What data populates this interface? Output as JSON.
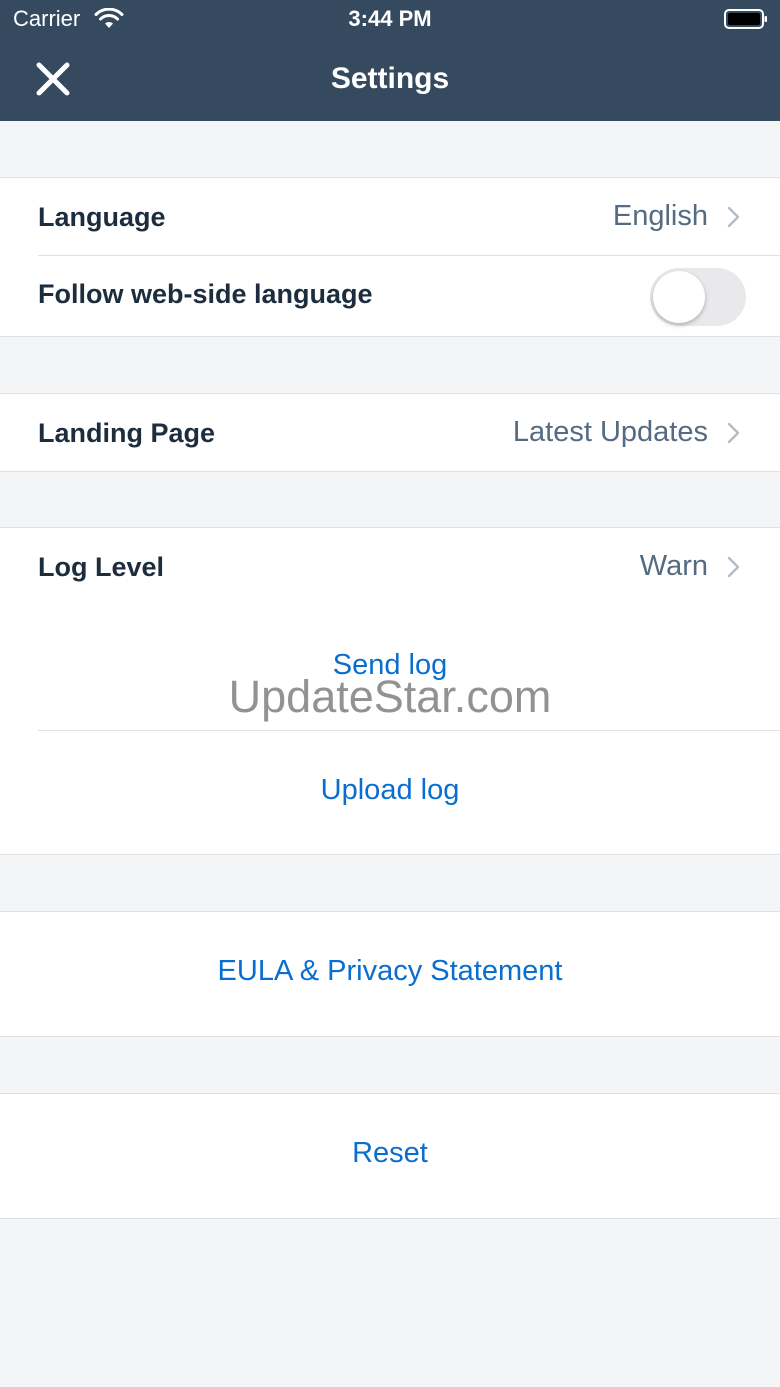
{
  "status_bar": {
    "carrier": "Carrier",
    "time": "3:44 PM"
  },
  "nav": {
    "title": "Settings",
    "close_icon": "close-icon"
  },
  "groups": {
    "language": {
      "language_label": "Language",
      "language_value": "English",
      "follow_label": "Follow web-side language",
      "follow_enabled": false
    },
    "landing": {
      "label": "Landing Page",
      "value": "Latest Updates"
    },
    "log": {
      "label": "Log Level",
      "value": "Warn",
      "send_log": "Send log",
      "upload_log": "Upload log"
    },
    "eula": {
      "label": "EULA & Privacy Statement"
    },
    "reset": {
      "label": "Reset"
    }
  },
  "watermark": "UpdateStar.com",
  "colors": {
    "header_bg": "#354a5f",
    "link": "#0a6ed1",
    "label": "#1d2d3e",
    "value": "#556b82",
    "background": "#f4f5f6"
  }
}
